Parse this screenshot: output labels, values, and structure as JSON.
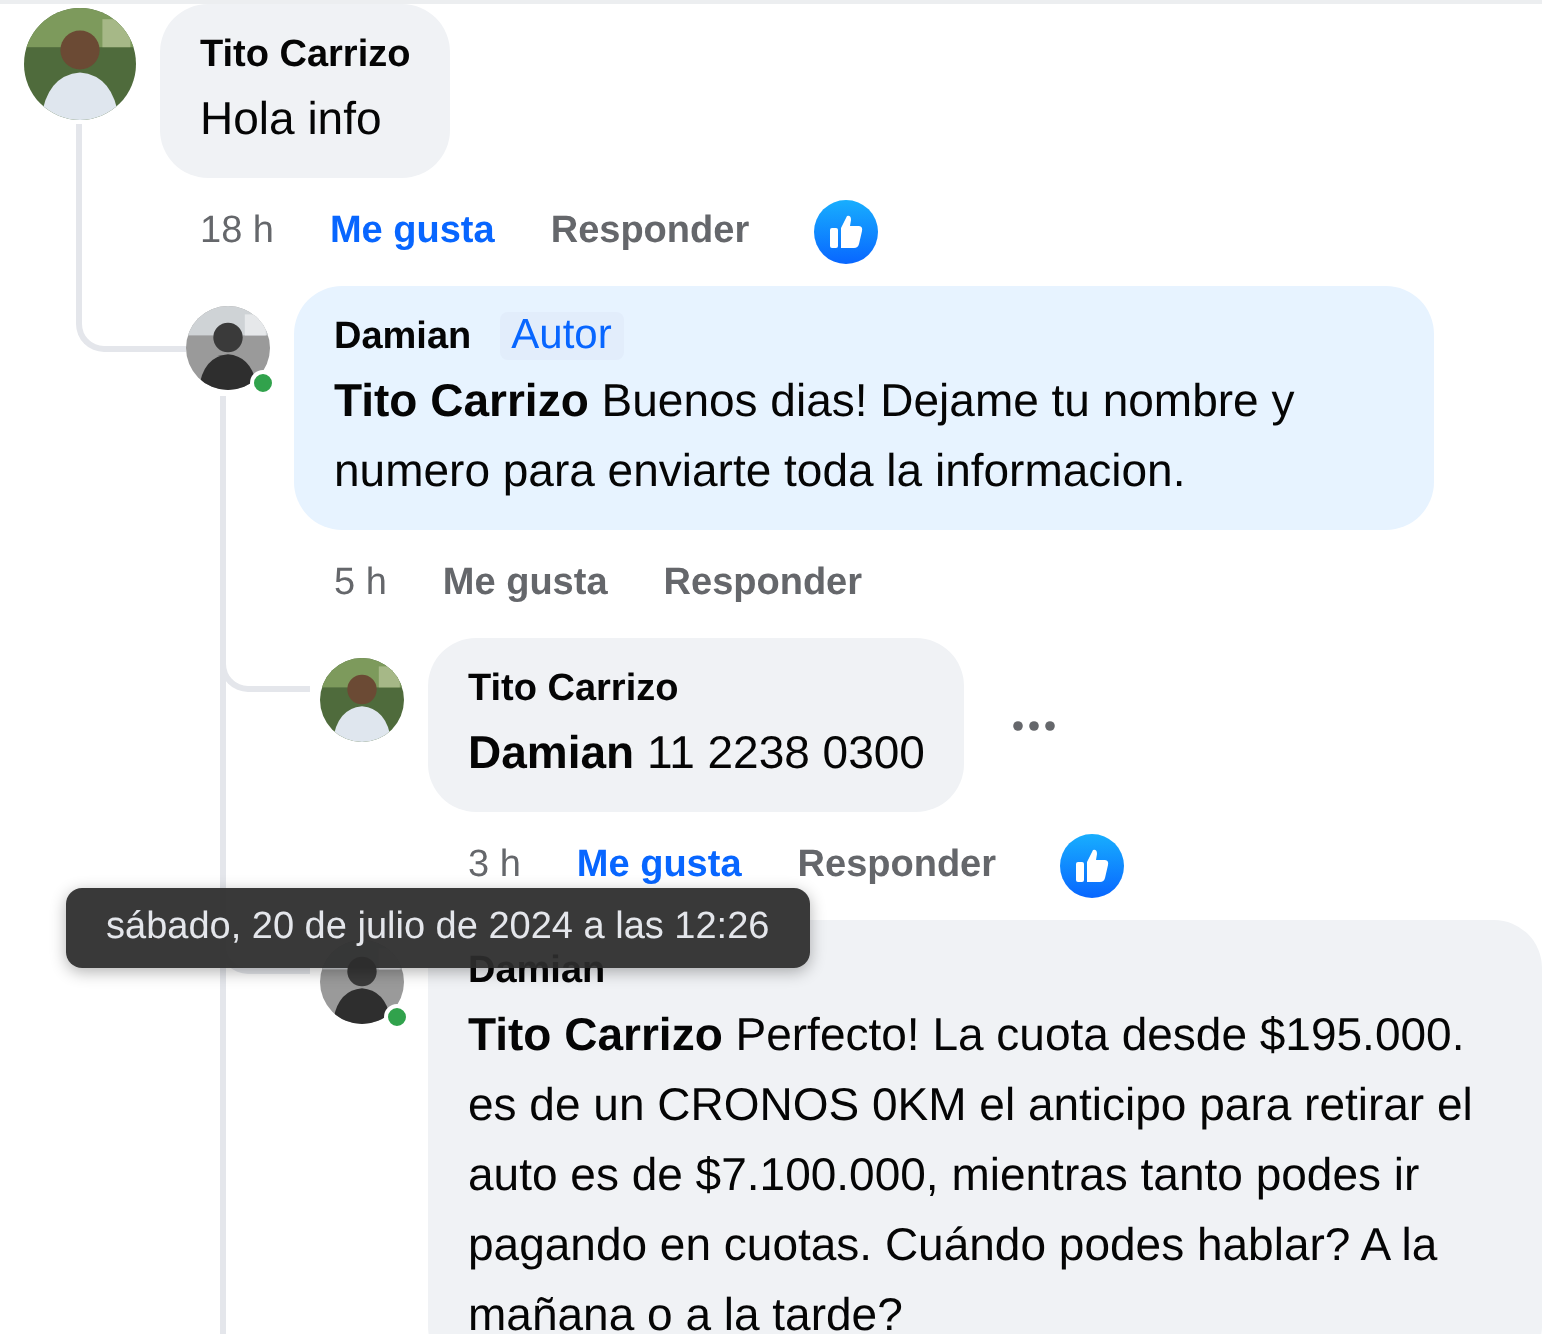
{
  "comments": [
    {
      "author": "Tito Carrizo",
      "text": "Hola info",
      "time": "18 h",
      "like_label": "Me gusta",
      "reply_label": "Responder",
      "liked": true,
      "reacted": true,
      "online": false,
      "replies": [
        {
          "author": "Damian",
          "badge": "Autor",
          "text": "**Tito Carrizo** Buenos dias! Dejame tu nombre y numero para enviarte toda la informacion.",
          "time": "5 h",
          "like_label": "Me gusta",
          "reply_label": "Responder",
          "liked": false,
          "reacted": false,
          "online": true,
          "replies": [
            {
              "author": "Tito Carrizo",
              "text": "**Damian** 11 2238 0300",
              "time": "3 h",
              "like_label": "Me gusta",
              "reply_label": "Responder",
              "liked": true,
              "reacted": true,
              "online": false,
              "menu_shown": true
            },
            {
              "author": "Damian",
              "text": "**Tito Carrizo** Perfecto! La cuota desde $195.000. es de un CRONOS 0KM el anticipo para retirar el auto es de $7.100.000, mientras tanto podes ir pagando en cuotas. Cuándo podes hablar? A la mañana o a la tarde?",
              "online": true
            }
          ]
        }
      ]
    }
  ],
  "tooltip": "sábado, 20 de julio de 2024 a las 12:26"
}
